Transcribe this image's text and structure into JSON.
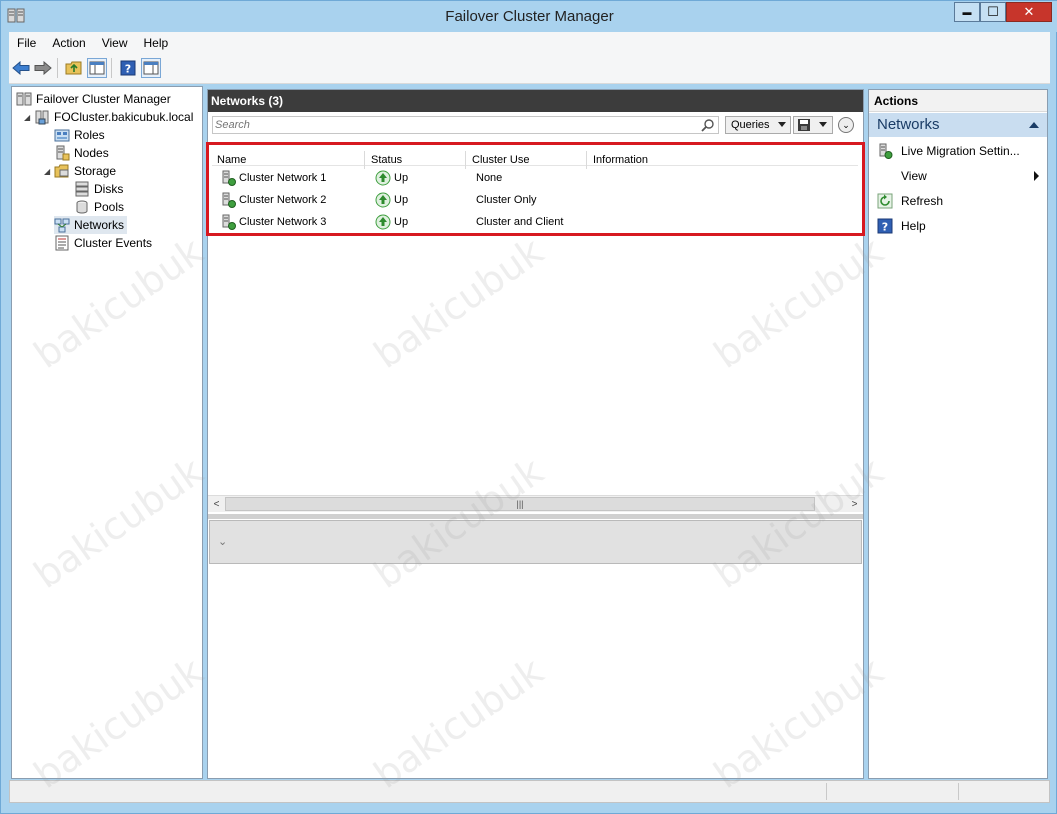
{
  "window": {
    "title": "Failover Cluster Manager",
    "controls": {
      "minimize": "▬",
      "maximize": "☐",
      "close": "✕"
    }
  },
  "menu": {
    "items": [
      "File",
      "Action",
      "View",
      "Help"
    ]
  },
  "tree": {
    "root": "Failover Cluster Manager",
    "cluster": "FOCluster.bakicubuk.local",
    "roles": "Roles",
    "nodes": "Nodes",
    "storage": "Storage",
    "disks": "Disks",
    "pools": "Pools",
    "networks": "Networks",
    "events": "Cluster Events"
  },
  "center": {
    "header": "Networks (3)",
    "search_placeholder": "Search",
    "queries_label": "Queries",
    "columns": [
      "Name",
      "Status",
      "Cluster Use",
      "Information"
    ],
    "rows": [
      {
        "name": "Cluster Network 1",
        "status": "Up",
        "cluster_use": "None",
        "information": ""
      },
      {
        "name": "Cluster Network 2",
        "status": "Up",
        "cluster_use": "Cluster Only",
        "information": ""
      },
      {
        "name": "Cluster Network 3",
        "status": "Up",
        "cluster_use": "Cluster and Client",
        "information": ""
      }
    ],
    "scroll_thumb_glyph": "|||"
  },
  "actions": {
    "title": "Actions",
    "section": "Networks",
    "items": [
      "Live Migration Settin...",
      "View",
      "Refresh",
      "Help"
    ]
  },
  "watermark_text": "bakicubuk",
  "colors": {
    "titlebar": "#a9d2ee",
    "highlight_border": "#d71920",
    "header_dark": "#3c3c3c",
    "status_up": "#3f9f3f",
    "actions_section": "#c9ddf0"
  }
}
